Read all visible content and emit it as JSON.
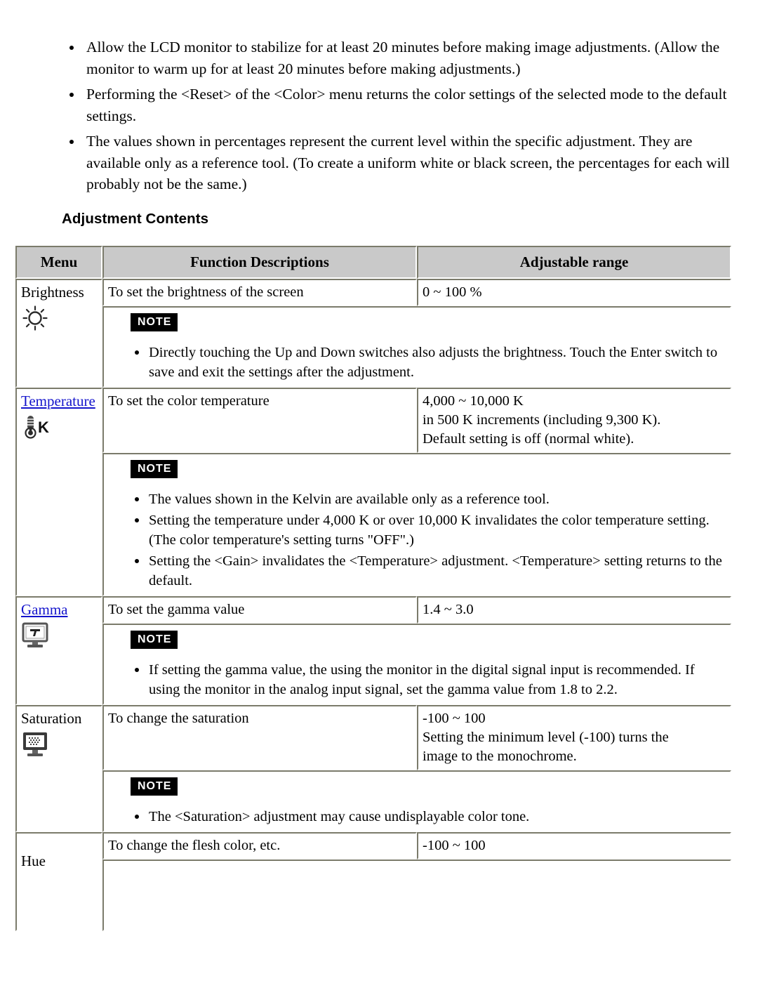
{
  "intro_bullets": [
    "Allow the LCD monitor to stabilize for at least 20 minutes before making image adjustments. (Allow the monitor to warm up for at least 20 minutes before making adjustments.)",
    "Performing the <Reset> of the <Color> menu returns the color settings of the selected mode to the default settings.",
    "The values shown in percentages represent the current level within the specific adjustment. They are available only as a reference tool. (To create a uniform white or black screen, the percentages for each will probably not be the same.)"
  ],
  "section_heading": "Adjustment Contents",
  "note_badge_label": "NOTE",
  "table": {
    "headers": {
      "menu": "Menu",
      "function_descriptions": "Function Descriptions",
      "adjustable_range": "Adjustable range"
    },
    "rows": [
      {
        "menu_label": "Brightness",
        "menu_is_link": false,
        "icon": "brightness-sun-icon",
        "description": "To set the brightness of the screen",
        "range": "0 ~ 100 %",
        "notes": [
          "Directly touching the Up and Down switches also adjusts the brightness. Touch the Enter switch to save and exit the settings after the adjustment."
        ]
      },
      {
        "menu_label": "Temperature",
        "menu_is_link": true,
        "icon": "thermometer-kelvin-icon",
        "description": "To set the color temperature",
        "range": "4,000 ~ 10,000 K\nin 500 K increments (including 9,300 K).\nDefault setting is off (normal white).",
        "notes": [
          "The values shown in the Kelvin are available only as a reference tool.",
          "Setting the temperature under 4,000 K or over 10,000 K invalidates the color temperature setting. (The color temperature's setting turns \"OFF\".)",
          "Setting the <Gain> invalidates the <Temperature> adjustment. <Temperature> setting returns to the default."
        ]
      },
      {
        "menu_label": "Gamma",
        "menu_is_link": true,
        "icon": "monitor-gamma-icon",
        "description": "To set the gamma value",
        "range": "1.4 ~ 3.0",
        "notes": [
          "If setting the gamma value, the using the monitor in the digital signal input is recommended. If using the monitor in the analog input signal, set the gamma value from 1.8 to 2.2."
        ]
      },
      {
        "menu_label": "Saturation",
        "menu_is_link": false,
        "icon": "monitor-saturation-icon",
        "description": "To change the saturation",
        "range": "-100 ~ 100\nSetting the minimum level (-100) turns the\nimage to the monochrome.",
        "notes": [
          "The <Saturation> adjustment may cause undisplayable color tone."
        ]
      },
      {
        "menu_label": "Hue",
        "menu_is_link": false,
        "icon": "none",
        "description": "To change the flesh color, etc.",
        "range": "-100 ~ 100",
        "notes": []
      }
    ]
  },
  "colors": {
    "header_background": "#c9c9c9",
    "border_dark": "#7b7b6b",
    "border_light": "#ffffff",
    "link": "#1414cc",
    "note_badge_background": "#000000",
    "note_badge_text": "#ffffff",
    "page_background": "#ffffff"
  }
}
